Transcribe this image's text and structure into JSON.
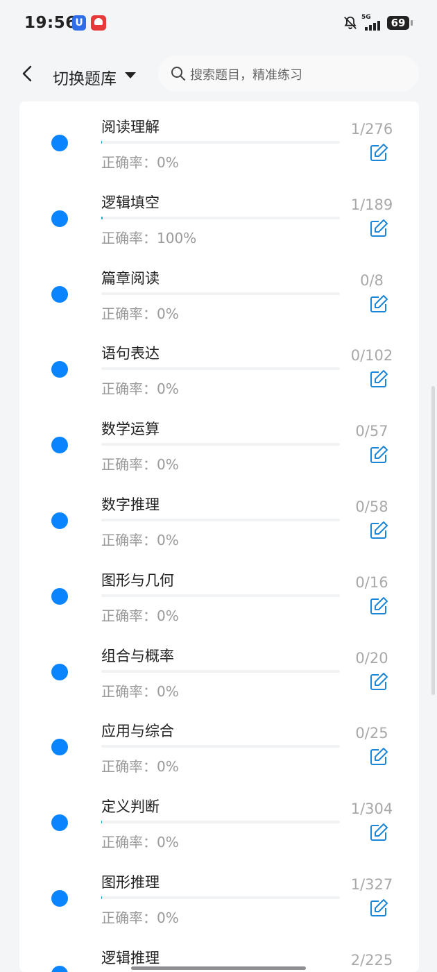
{
  "status_bar": {
    "time": "19:56",
    "network": "5G",
    "battery": "69"
  },
  "header": {
    "title": "切换题库",
    "search_placeholder": "搜索题目，精准练习"
  },
  "accuracy_prefix": "正确率：",
  "items": [
    {
      "title": "阅读理解",
      "accuracy": "0%",
      "count": "1/276",
      "progress": 0.0036
    },
    {
      "title": "逻辑填空",
      "accuracy": "100%",
      "count": "1/189",
      "progress": 0.0053
    },
    {
      "title": "篇章阅读",
      "accuracy": "0%",
      "count": "0/8",
      "progress": 0
    },
    {
      "title": "语句表达",
      "accuracy": "0%",
      "count": "0/102",
      "progress": 0
    },
    {
      "title": "数学运算",
      "accuracy": "0%",
      "count": "0/57",
      "progress": 0
    },
    {
      "title": "数字推理",
      "accuracy": "0%",
      "count": "0/58",
      "progress": 0
    },
    {
      "title": "图形与几何",
      "accuracy": "0%",
      "count": "0/16",
      "progress": 0
    },
    {
      "title": "组合与概率",
      "accuracy": "0%",
      "count": "0/20",
      "progress": 0
    },
    {
      "title": "应用与综合",
      "accuracy": "0%",
      "count": "0/25",
      "progress": 0
    },
    {
      "title": "定义判断",
      "accuracy": "0%",
      "count": "1/304",
      "progress": 0.0033
    },
    {
      "title": "图形推理",
      "accuracy": "0%",
      "count": "1/327",
      "progress": 0.0031
    },
    {
      "title": "逻辑推理",
      "accuracy": "",
      "count": "2/225",
      "progress": 0.0089
    }
  ],
  "colors": {
    "dot": "#0a84ff",
    "edit_icon": "#1a86d8",
    "progress_fill": "#1fa4c9"
  }
}
